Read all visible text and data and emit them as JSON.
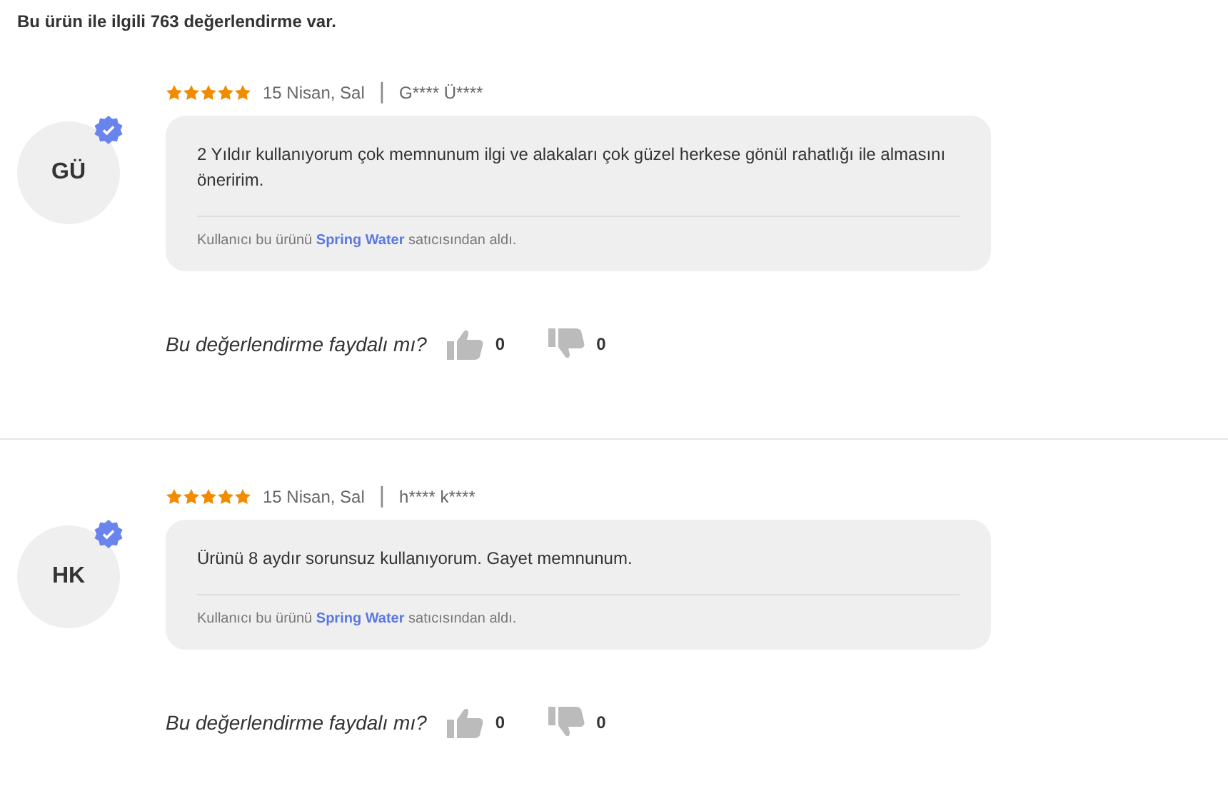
{
  "heading": "Bu ürün ile ilgili 763 değerlendirme var.",
  "reviews": [
    {
      "initials": "GÜ",
      "verified": true,
      "stars": 5,
      "date": "15 Nisan, Sal",
      "separator": "|",
      "author": "G**** Ü****",
      "text": "2 Yıldır kullanıyorum çok memnunum ilgi ve alakaları çok güzel herkese gönül rahatlığı ile almasını öneririm.",
      "seller_prefix": "Kullanıcı bu ürünü",
      "seller": "Spring Water",
      "seller_suffix": "satıcısından aldı.",
      "helpful_question": "Bu değerlendirme faydalı mı?",
      "likes": "0",
      "dislikes": "0"
    },
    {
      "initials": "HK",
      "verified": true,
      "stars": 5,
      "date": "15 Nisan, Sal",
      "separator": "|",
      "author": "h**** k****",
      "text": "Ürünü 8 aydır sorunsuz kullanıyorum. Gayet memnunum.",
      "seller_prefix": "Kullanıcı bu ürünü",
      "seller": "Spring Water",
      "seller_suffix": "satıcısından aldı.",
      "helpful_question": "Bu değerlendirme faydalı mı?",
      "likes": "0",
      "dislikes": "0"
    }
  ]
}
